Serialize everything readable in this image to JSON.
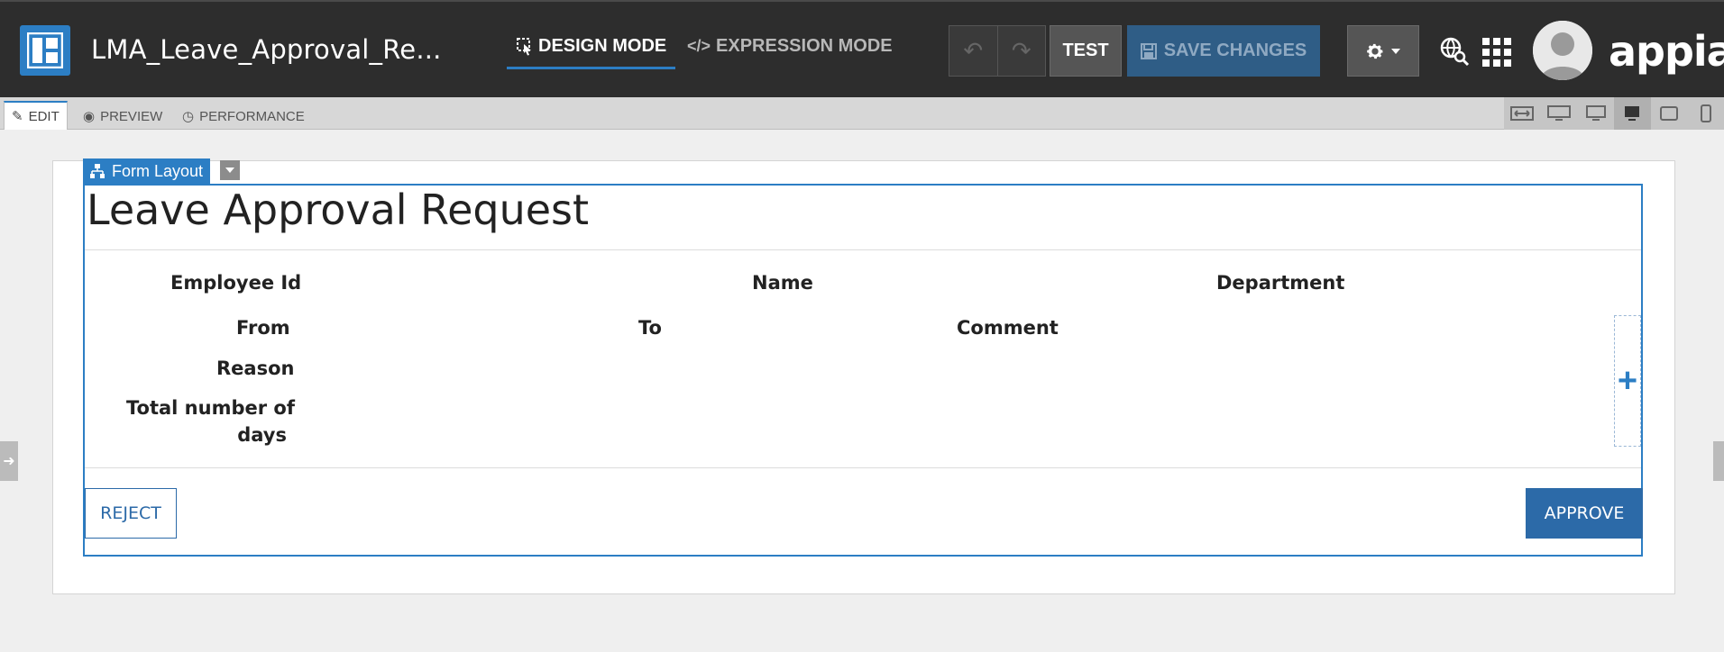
{
  "header": {
    "app_title": "LMA_Leave_Approval_Re...",
    "modes": {
      "design": "DESIGN MODE",
      "expression": "EXPRESSION MODE"
    },
    "test_label": "TEST",
    "save_label": "SAVE CHANGES",
    "logo_text": "appian",
    "undo_icon": "undo-icon",
    "redo_icon": "redo-icon"
  },
  "tabs": [
    {
      "label": "EDIT",
      "icon": "edit-icon"
    },
    {
      "label": "PREVIEW",
      "icon": "eye-icon"
    },
    {
      "label": "PERFORMANCE",
      "icon": "clock-icon"
    }
  ],
  "form": {
    "layout_label": "Form Layout",
    "title": "Leave Approval Request",
    "fields": {
      "employee_id": "Employee Id",
      "name": "Name",
      "department": "Department",
      "from": "From",
      "to": "To",
      "comment": "Comment",
      "reason": "Reason",
      "total_days_line1": "Total number of",
      "total_days_line2": "days"
    },
    "buttons": {
      "reject": "REJECT",
      "approve": "APPROVE"
    }
  },
  "colors": {
    "accent": "#2c7ec4",
    "topbar": "#2d2d2d",
    "button": "#2c6aa8"
  }
}
